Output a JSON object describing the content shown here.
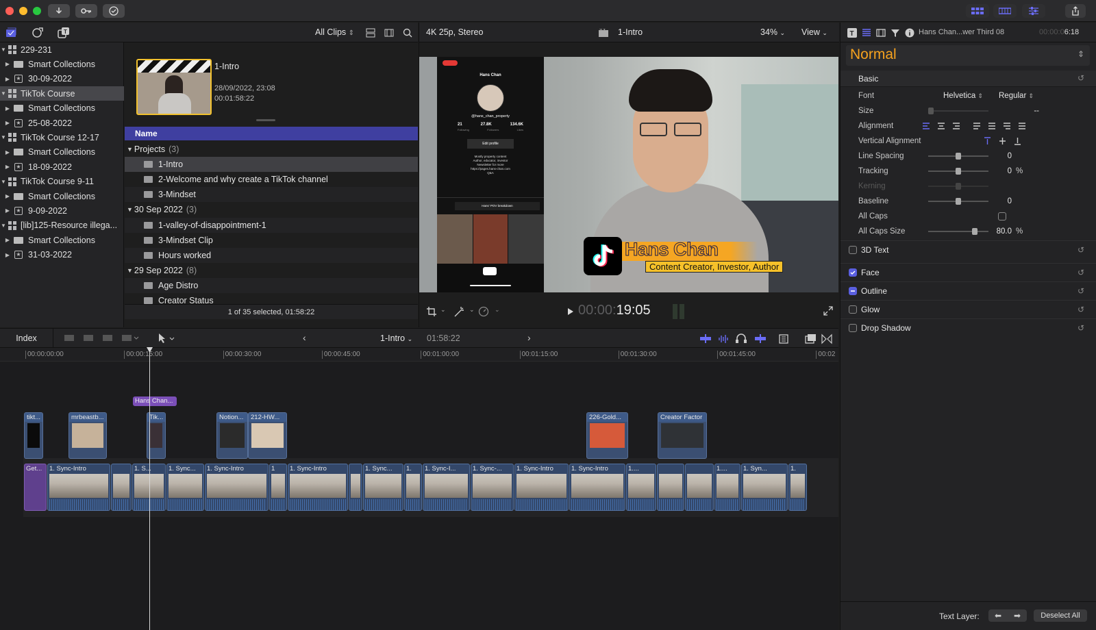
{
  "colors": {
    "accent": "#5a5fe0",
    "selection_yellow": "#f2c12e",
    "title_orange": "#f5a623"
  },
  "toolbar": {
    "import_icon": "download-icon",
    "keywords_icon": "key-icon",
    "background_tasks_icon": "check-circle-icon"
  },
  "library_bar": {
    "filter": "All Clips"
  },
  "sidebar": {
    "items": [
      {
        "label": "229-231",
        "kind": "library",
        "indent": 0
      },
      {
        "label": "Smart Collections",
        "kind": "folder",
        "indent": 1
      },
      {
        "label": "30-09-2022",
        "kind": "event",
        "indent": 1
      },
      {
        "label": "TikTok Course",
        "kind": "library",
        "indent": 0,
        "selected": true
      },
      {
        "label": "Smart Collections",
        "kind": "folder",
        "indent": 1
      },
      {
        "label": "25-08-2022",
        "kind": "event",
        "indent": 1
      },
      {
        "label": "TikTok Course 12-17",
        "kind": "library",
        "indent": 0
      },
      {
        "label": "Smart Collections",
        "kind": "folder",
        "indent": 1
      },
      {
        "label": "18-09-2022",
        "kind": "event",
        "indent": 1
      },
      {
        "label": "TikTok Course 9-11",
        "kind": "library",
        "indent": 0
      },
      {
        "label": "Smart Collections",
        "kind": "folder",
        "indent": 1
      },
      {
        "label": "9-09-2022",
        "kind": "event",
        "indent": 1
      },
      {
        "label": "[lib]125-Resource illega...",
        "kind": "library",
        "indent": 0
      },
      {
        "label": "Smart Collections",
        "kind": "folder",
        "indent": 1
      },
      {
        "label": "31-03-2022",
        "kind": "event",
        "indent": 1
      }
    ]
  },
  "browser": {
    "filmstrip": {
      "title": "1-Intro",
      "date": "28/09/2022, 23:08",
      "duration": "00:01:58:22"
    },
    "column_name": "Name",
    "groups": [
      {
        "label": "Projects",
        "count": "(3)",
        "items": [
          "1-Intro",
          "2-Welcome and why create a TikTok channel",
          "3-Mindset"
        ]
      },
      {
        "label": "30 Sep 2022",
        "count": "(3)",
        "items": [
          "1-valley-of-disappointment-1",
          "3-Mindset Clip",
          "Hours worked"
        ]
      },
      {
        "label": "29 Sep 2022",
        "count": "(8)",
        "items": [
          "Age Distro",
          "Creator Status"
        ]
      }
    ],
    "status": "1 of 35 selected, 01:58:22"
  },
  "viewer": {
    "format": "4K 25p, Stereo",
    "project": "1-Intro",
    "zoom": "34%",
    "view_label": "View",
    "timecode_dim": "00:00:",
    "timecode": "19:05",
    "phone": {
      "username": "Hans Chan",
      "handle": "@hans_chan_property",
      "stats": [
        {
          "n": "21",
          "l": "Following"
        },
        {
          "n": "27.8K",
          "l": "Followers"
        },
        {
          "n": "134.6K",
          "l": "Likes"
        }
      ],
      "edit": "Edit profile",
      "bio1": "Mostly property content",
      "bio2": "Author, educator, investor",
      "bio3": "Newsletter for more",
      "link": "https://pages.hans-chan.com",
      "qa": "Q&A",
      "pov": "Hans' POV breakdown"
    },
    "lower_third": {
      "name": "Hans Chan",
      "subtitle": "Content Creator, Investor, Author"
    }
  },
  "inspector": {
    "clip_name": "Hans Chan...wer Third 08",
    "timecode_dim": "00:00:0",
    "timecode": "6:18",
    "preset": "Normal",
    "basic": "Basic",
    "font_label": "Font",
    "font_value": "Helvetica",
    "font_style": "Regular",
    "size_label": "Size",
    "size_value": "--",
    "alignment_label": "Alignment",
    "valign_label": "Vertical Alignment",
    "line_spacing_label": "Line Spacing",
    "line_spacing_value": "0",
    "tracking_label": "Tracking",
    "tracking_value": "0",
    "tracking_unit": "%",
    "kerning_label": "Kerning",
    "baseline_label": "Baseline",
    "baseline_value": "0",
    "allcaps_label": "All Caps",
    "allcaps_size_label": "All Caps Size",
    "allcaps_size_value": "80.0",
    "allcaps_size_unit": "%",
    "sections": [
      {
        "label": "3D Text",
        "checked": false
      },
      {
        "label": "Face",
        "checked": true
      },
      {
        "label": "Outline",
        "checked": "mixed"
      },
      {
        "label": "Glow",
        "checked": false
      },
      {
        "label": "Drop Shadow",
        "checked": false
      }
    ],
    "text_layer_label": "Text Layer:",
    "deselect_all": "Deselect All"
  },
  "timeline": {
    "index": "Index",
    "project": "1-Intro",
    "duration": "01:58:22",
    "ruler": [
      "00:00:00:00",
      "00:00:15:00",
      "00:00:30:00",
      "00:00:45:00",
      "00:01:00:00",
      "00:01:15:00",
      "00:01:30:00",
      "00:01:45:00",
      "00:02"
    ],
    "title_clip": "Hans Chan...",
    "broll": [
      "tikt...",
      "mrbeastb...",
      "Tik...",
      "Notion...",
      "212-HW...",
      "226-Gold...",
      "Creator Factor"
    ],
    "primary": [
      "Get...",
      "1. Sync-Intro",
      "",
      "1. S...",
      "1. Sync...",
      "1. Sync-Intro",
      "1",
      "1. Sync-Intro",
      "",
      "1. Sync...",
      "1.",
      "1. Sync-I...",
      "1. Sync-...",
      "1. Sync-Intro",
      "1. Sync-Intro",
      "1....",
      "",
      "",
      "1....",
      "1. Syn...",
      "1."
    ]
  }
}
